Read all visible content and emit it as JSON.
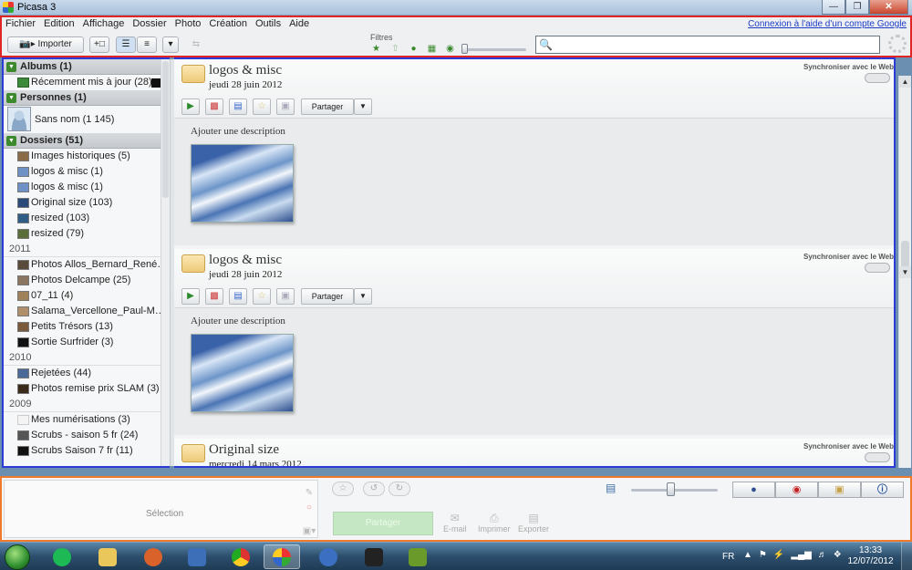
{
  "window": {
    "title": "Picasa 3"
  },
  "menu": [
    "Fichier",
    "Edition",
    "Affichage",
    "Dossier",
    "Photo",
    "Création",
    "Outils",
    "Aide"
  ],
  "google_link": "Connexion à l'aide d'un compte Google",
  "toolbar": {
    "import_label": "Importer",
    "filters_label": "Filtres",
    "search_placeholder": ""
  },
  "sidebar": {
    "albums_header": "Albums (1)",
    "albums": [
      {
        "label": "Récemment mis à jour (28)"
      }
    ],
    "people_header": "Personnes (1)",
    "people": [
      {
        "label": "Sans nom (1 145)"
      }
    ],
    "folders_header": "Dossiers (51)",
    "folders_top": [
      {
        "label": "Images historiques (5)"
      },
      {
        "label": "logos & misc (1)"
      },
      {
        "label": "logos & misc (1)"
      },
      {
        "label": "Original size (103)"
      },
      {
        "label": "resized (103)"
      },
      {
        "label": "resized (79)"
      }
    ],
    "year_2011": "2011",
    "folders_2011": [
      {
        "label": "Photos Allos_Bernard_René_..."
      },
      {
        "label": "Photos Delcampe (25)"
      },
      {
        "label": "07_11 (4)"
      },
      {
        "label": "Salama_Vercellone_Paul-Malle..."
      },
      {
        "label": "Petits Trésors (13)"
      },
      {
        "label": "Sortie Surfrider (3)"
      }
    ],
    "year_2010": "2010",
    "folders_2010": [
      {
        "label": "Rejetées (44)"
      },
      {
        "label": "Photos remise prix  SLAM (3)"
      }
    ],
    "year_2009": "2009",
    "folders_2009": [
      {
        "label": "Mes numérisations (3)"
      },
      {
        "label": "Scrubs - saison 5 fr (24)"
      },
      {
        "label": "Scrubs Saison 7 fr (11)"
      }
    ]
  },
  "albums": [
    {
      "title": "logos & misc",
      "date": "jeudi 28 juin 2012",
      "sync": "Synchroniser avec le Web",
      "share": "Partager",
      "description": "Ajouter une description"
    },
    {
      "title": "logos & misc",
      "date": "jeudi 28 juin 2012",
      "sync": "Synchroniser avec le Web",
      "share": "Partager",
      "description": "Ajouter une description"
    },
    {
      "title": "Original size",
      "date": "mercredi 14 mars 2012",
      "sync": "Synchroniser avec le Web"
    }
  ],
  "tray": {
    "selection_label": "Sélection",
    "share_label": "Partager",
    "email_label": "E-mail",
    "print_label": "Imprimer",
    "export_label": "Exporter"
  },
  "taskbar": {
    "lang": "FR",
    "time": "13:33",
    "date": "12/07/2012"
  }
}
